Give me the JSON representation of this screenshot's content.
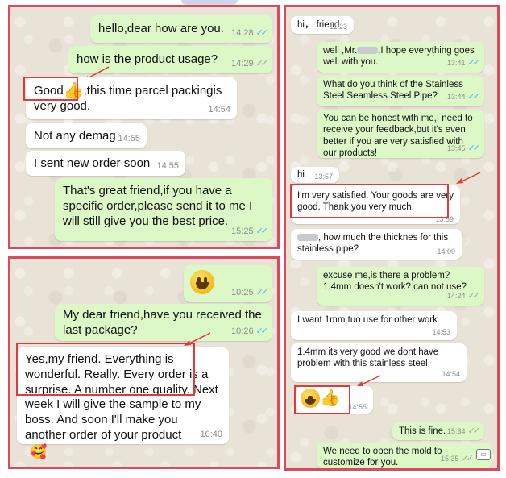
{
  "panel_a": {
    "messages": [
      {
        "text": "hello,dear how are you.",
        "time": "14:28"
      },
      {
        "text": "how is the  product usage?",
        "time": "14:29"
      },
      {
        "text_before": "Good",
        "text_after": ",this time parcel packingis very good.",
        "time": "14:54"
      },
      {
        "text": "Not any demag",
        "time": "14:55"
      },
      {
        "text": "I sent new order soon",
        "time": "14:55"
      },
      {
        "text": "That's great friend,if you have a specific order,please send it to me I will still give you the best price.",
        "time": "15:25"
      }
    ]
  },
  "panel_b": {
    "messages": [
      {
        "time": "10:25"
      },
      {
        "text": "My dear  friend,have you received the last package?",
        "time": "10:26"
      },
      {
        "text": "Yes,my friend. Everything is wonderful. Really. Every order is a surprise. A number one quality. Next week I will give the sample to my boss. And soon I'll make you another order of your product",
        "time": "10:40"
      }
    ]
  },
  "panel_c": {
    "messages": [
      {
        "text": "hi， friend",
        "time": "11:23"
      },
      {
        "text_before": "well ,Mr.",
        "text_after": ",I hope everything goes well with you.",
        "time": "13:41"
      },
      {
        "text": "What do you think of the Stainless Steel Seamless Steel Pipe?",
        "time": "13:44"
      },
      {
        "text": "You can be honest with me,I need to receive your feedback,but it's even better if you are very satisfied with our products!",
        "time": "13:45"
      },
      {
        "text": "hi",
        "time": "13:57"
      },
      {
        "text": "I'm very satisfied. Your goods are very good. Thank you very much.",
        "time": "13:59"
      },
      {
        "text": ", how much the thicknes for this stainless pipe?",
        "time": "14:00"
      },
      {
        "text": "excuse me,is there a problem? 1.4mm doesn't work? can not use?",
        "time": "14:24"
      },
      {
        "text": "I want 1mm tuo use for other work",
        "time": "14:53"
      },
      {
        "text": "1.4mm its very good we dont have problem with this stainless steel",
        "time": "14:54"
      },
      {
        "time": "14:55"
      },
      {
        "text": "This is  fine.",
        "time": "15:34"
      },
      {
        "text": "We need to open  the mold to customize for you.",
        "time": "15:35"
      }
    ]
  },
  "colors": {
    "frame": "#d94a5c",
    "outgoing": "#dcf8c6",
    "incoming": "#ffffff",
    "highlight": "#e03a3a",
    "read_ticks": "#4fb6ec"
  },
  "icons": [
    "grinning-face-emoji",
    "thumbs-up-emoji",
    "smiling-hearts-emoji",
    "double-check-icon"
  ]
}
